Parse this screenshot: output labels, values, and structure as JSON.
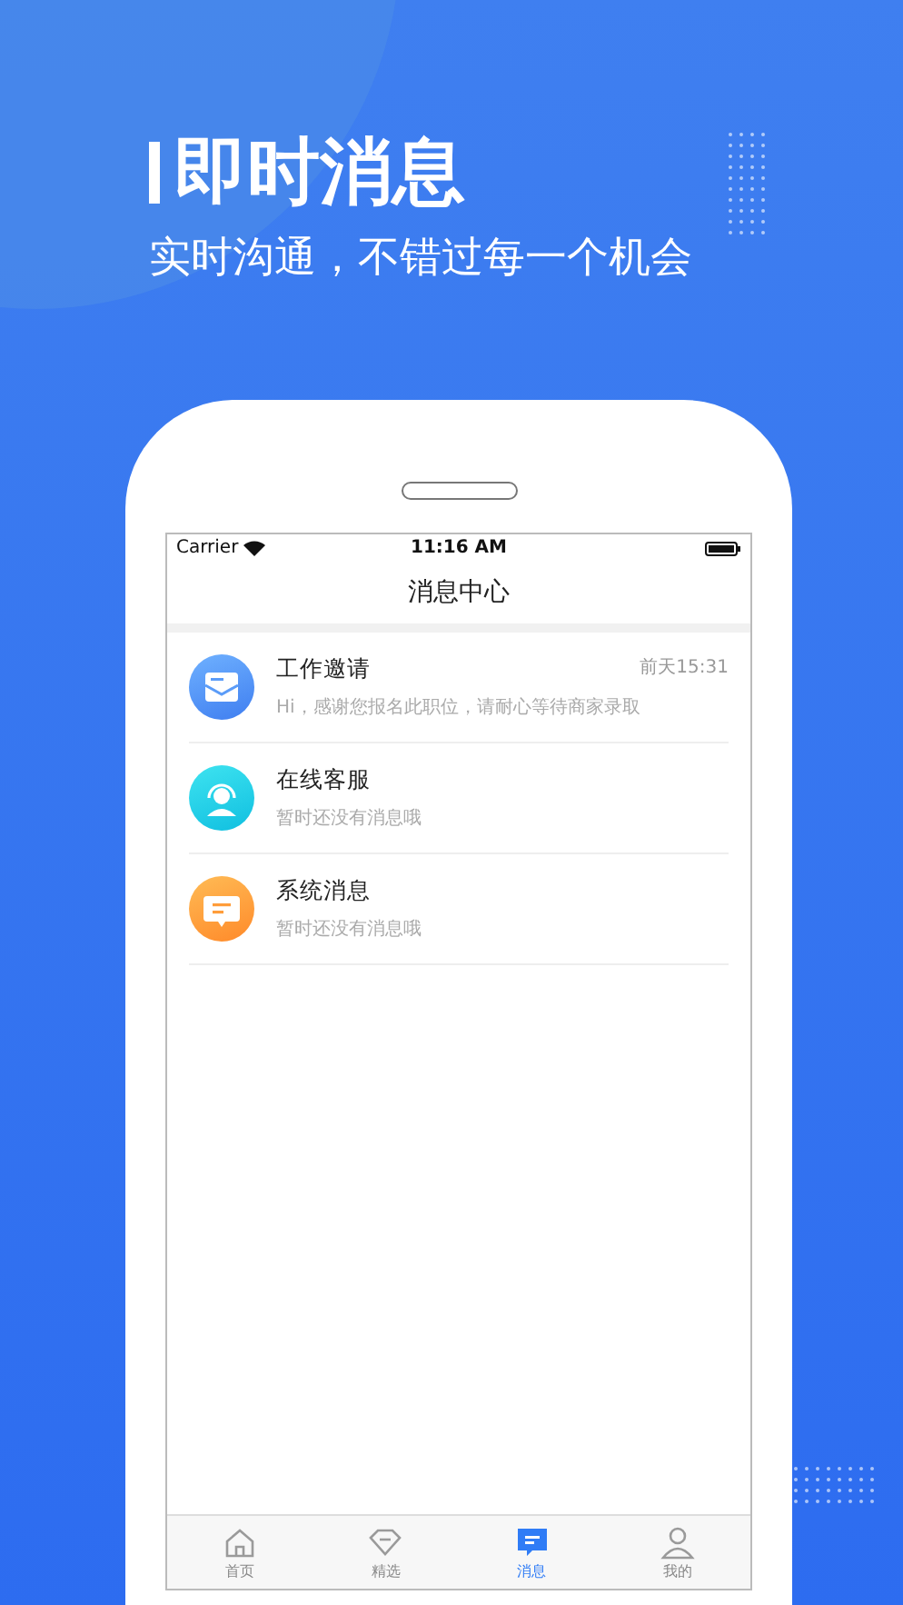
{
  "headline": "即时消息",
  "subtitle": "实时沟通，不错过每一个机会",
  "status_bar": {
    "carrier": "Carrier",
    "time": "11:16 AM"
  },
  "nav": {
    "title": "消息中心"
  },
  "messages": [
    {
      "kind": "mail",
      "title": "工作邀请",
      "preview": "Hi，感谢您报名此职位，请耐心等待商家录取",
      "time": "前天15:31"
    },
    {
      "kind": "service",
      "title": "在线客服",
      "preview": "暂时还没有消息哦"
    },
    {
      "kind": "system",
      "title": "系统消息",
      "preview": "暂时还没有消息哦"
    }
  ],
  "tabs": [
    {
      "kind": "home",
      "label": "首页",
      "selected": false
    },
    {
      "kind": "gem",
      "label": "精选",
      "selected": false
    },
    {
      "kind": "message",
      "label": "消息",
      "selected": true
    },
    {
      "kind": "user",
      "label": "我的",
      "selected": false
    }
  ]
}
